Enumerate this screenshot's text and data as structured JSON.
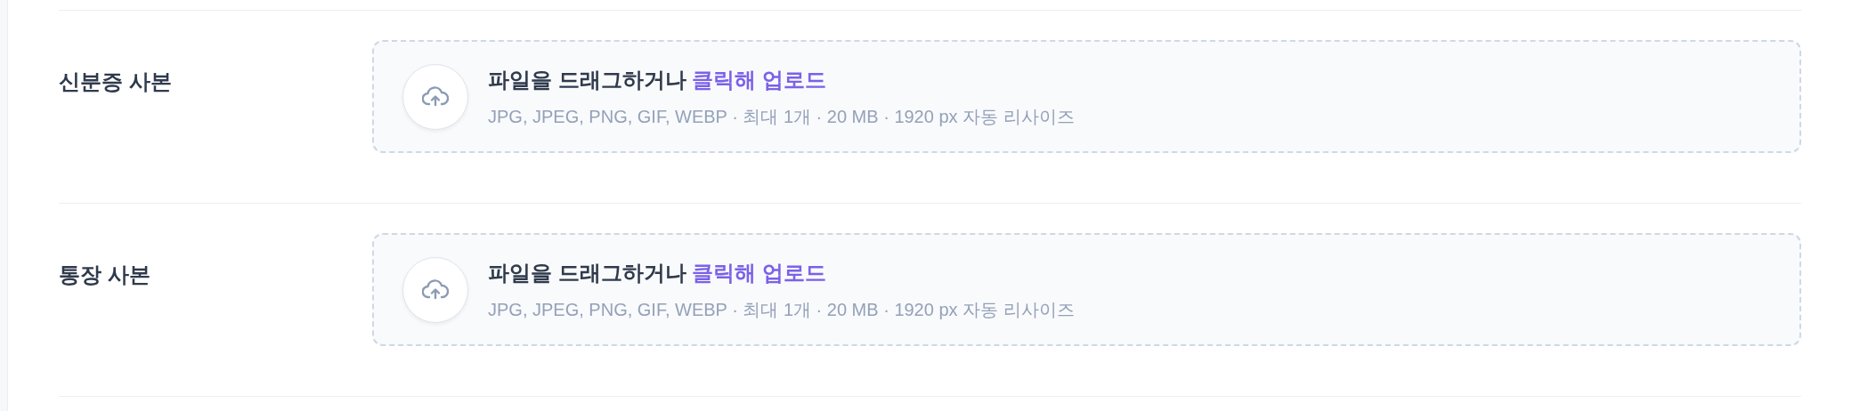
{
  "fields": [
    {
      "label": "신분증 사본",
      "upload": {
        "prompt": "파일을 드래그하거나",
        "link": "클릭해 업로드",
        "hint": "JPG, JPEG, PNG, GIF, WEBP · 최대 1개 · 20 MB · 1920 px 자동 리사이즈"
      }
    },
    {
      "label": "통장 사본",
      "upload": {
        "prompt": "파일을 드래그하거나",
        "link": "클릭해 업로드",
        "hint": "JPG, JPEG, PNG, GIF, WEBP · 최대 1개 · 20 MB · 1920 px 자동 리사이즈"
      }
    }
  ]
}
